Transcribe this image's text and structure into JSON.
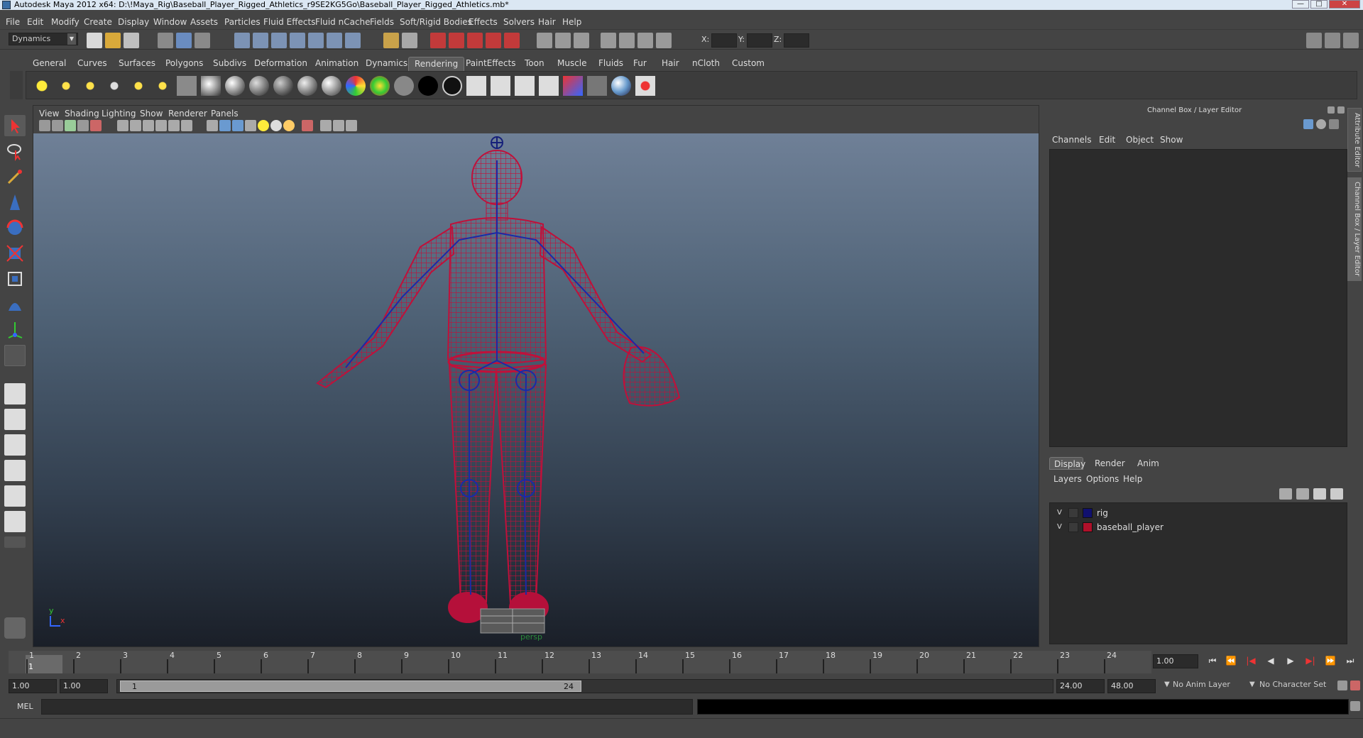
{
  "window": {
    "title": "Autodesk Maya 2012 x64: D:\\!Maya_Rig\\Baseball_Player_Rigged_Athletics_r9SE2KG5Go\\Baseball_Player_Rigged_Athletics.mb*",
    "min": "—",
    "max": "□",
    "close": "✕"
  },
  "menu": [
    "File",
    "Edit",
    "Modify",
    "Create",
    "Display",
    "Window",
    "Assets",
    "Particles",
    "Fluid Effects",
    "Fluid nCache",
    "Fields",
    "Soft/Rigid Bodies",
    "Effects",
    "Solvers",
    "Hair",
    "Help"
  ],
  "status": {
    "menuset": "Dynamics",
    "x_label": "X:",
    "y_label": "Y:",
    "z_label": "Z:"
  },
  "shelf_tabs": [
    "General",
    "Curves",
    "Surfaces",
    "Polygons",
    "Subdivs",
    "Deformation",
    "Animation",
    "Dynamics",
    "Rendering",
    "PaintEffects",
    "Toon",
    "Muscle",
    "Fluids",
    "Fur",
    "Hair",
    "nCloth",
    "Custom"
  ],
  "active_shelf": "Rendering",
  "viewport": {
    "menus": [
      "View",
      "Shading",
      "Lighting",
      "Show",
      "Renderer",
      "Panels"
    ],
    "camera": "persp",
    "axis_x": "x",
    "axis_y": "y"
  },
  "channel_box": {
    "title": "Channel Box / Layer Editor",
    "menus": [
      "Channels",
      "Edit",
      "Object",
      "Show"
    ]
  },
  "layer_editor": {
    "tabs": [
      "Display",
      "Render",
      "Anim"
    ],
    "active_tab": "Display",
    "menus": [
      "Layers",
      "Options",
      "Help"
    ],
    "layers": [
      {
        "v": "V",
        "name": "rig",
        "color": "#10106e"
      },
      {
        "v": "V",
        "name": "baseball_player",
        "color": "#b0102a"
      }
    ]
  },
  "side_tabs": [
    "Attribute Editor",
    "Channel Box / Layer Editor"
  ],
  "timeline": {
    "ticks": [
      "1",
      "2",
      "3",
      "4",
      "5",
      "6",
      "7",
      "8",
      "9",
      "10",
      "11",
      "12",
      "13",
      "14",
      "15",
      "16",
      "17",
      "18",
      "19",
      "20",
      "21",
      "22",
      "23",
      "24"
    ],
    "current": "1",
    "current_field": "1.00"
  },
  "range": {
    "start": "1.00",
    "playback_start": "1.00",
    "slider_start": "1",
    "slider_end": "24",
    "playback_end": "24.00",
    "end": "48.00",
    "anim_layer": "No Anim Layer",
    "char_set": "No Character Set"
  },
  "command": {
    "label": "MEL"
  },
  "colors": {
    "wire": "#c0103a",
    "rig": "#1a2aa8",
    "accent_tab": "#5a5a5a"
  }
}
